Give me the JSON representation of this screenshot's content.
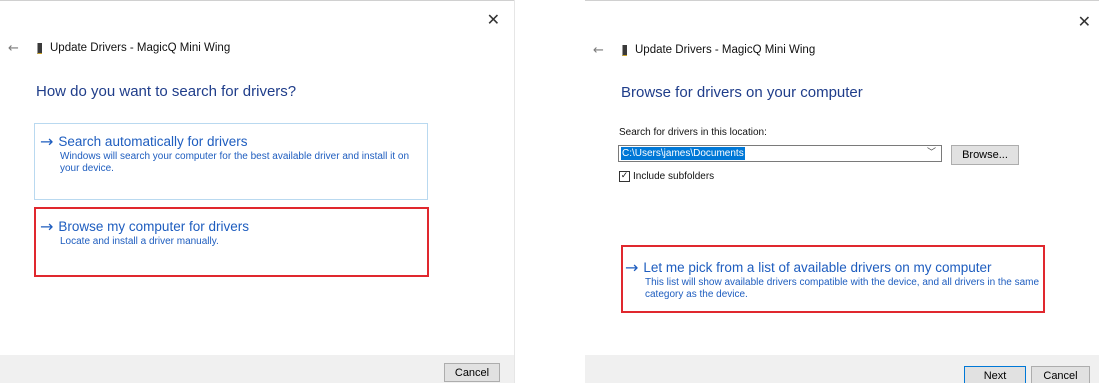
{
  "common": {
    "window_title": "Update Drivers - MagicQ Mini Wing",
    "back_glyph": "←",
    "close_glyph": "✕",
    "cancel_label": "Cancel"
  },
  "dialog1": {
    "heading": "How do you want to search for drivers?",
    "options": [
      {
        "title": "Search automatically for drivers",
        "desc": "Windows will search your computer for the best available driver and install it on your device.",
        "icon": "arrow-right-icon"
      },
      {
        "title": "Browse my computer for drivers",
        "desc": "Locate and install a driver manually.",
        "icon": "arrow-right-icon",
        "highlighted": true
      }
    ]
  },
  "dialog2": {
    "heading": "Browse for drivers on your computer",
    "location_label": "Search for drivers in this location:",
    "location_value": "C:\\Users\\james\\Documents",
    "browse_label": "Browse...",
    "include_subfolders_label": "Include subfolders",
    "include_subfolders_checked": true,
    "pick_option": {
      "title": "Let me pick from a list of available drivers on my computer",
      "desc": "This list will show available drivers compatible with the device, and all drivers in the same category as the device.",
      "highlighted": true
    },
    "next_label": "Next"
  },
  "colors": {
    "link_blue": "#1e5dbf",
    "heading_blue": "#1f3d8a",
    "highlight_red": "#e0282e",
    "footer_gray": "#f0f0f0"
  }
}
